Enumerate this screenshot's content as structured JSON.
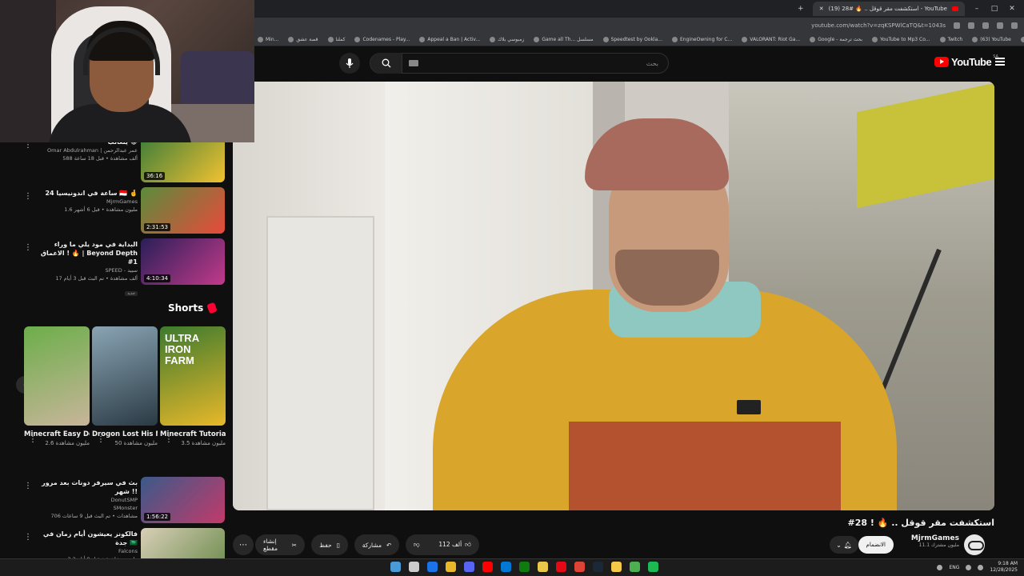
{
  "browser": {
    "tab_title": "(19) استكشفت مقر قوقل .. 🔥 #28 - YouTube",
    "url": "youtube.com/watch?v=zqKSPWlCaTQ&t=1043s",
    "bookmarks": [
      "Min...",
      "قصة عشق",
      "كملنا",
      "Codenames - Play...",
      "Appeal a Ban | Activ...",
      "زمبوسي بلاك",
      "Game all Th... مسلسل",
      "Speedtest by Ookla...",
      "EngineOwning for C...",
      "VALORANT: Riot Ga...",
      "Google - بحث ترجمة",
      "YouTube to Mp3 Co...",
      "Twitch",
      "(63) YouTube",
      "Kick",
      "Messages"
    ]
  },
  "header": {
    "search_placeholder": "بحث",
    "logo_text": "YouTube",
    "logo_region": "SA"
  },
  "recommendations": [
    {
      "title": "يتعالب 😂",
      "channel": "Omar Abdulrahman | عمر عبدالرحمن",
      "views": "588 ألف مشاهدة • قبل 18 ساعة",
      "duration": "36:16",
      "colors": [
        "#3e7d3a",
        "#f2c230"
      ]
    },
    {
      "title": "24 ساعة في اندونيسيا 🇮🇩 🤞",
      "channel": "MjrmGames",
      "views": "1.6 مليون مشاهدة • قبل 6 أشهر",
      "duration": "2:31:53",
      "colors": [
        "#5a8c3c",
        "#e84a3a"
      ]
    },
    {
      "title": "البداية في مود يلي ما وراء الاعماق ! 🔥 | Beyond Depth #1",
      "channel": "SPEED - سبيد",
      "views": "17 ألف مشاهدة • تم البث قبل 3 أيام",
      "duration": "4:10:34",
      "colors": [
        "#2a1f58",
        "#c23a8a"
      ],
      "chip": "جديد"
    }
  ],
  "shorts": {
    "heading": "Shorts",
    "items": [
      {
        "title": "Minecraft Easy Design...",
        "views": "2.6 مليون مشاهدة",
        "colors": [
          "#6cae4a",
          "#c8b59a"
        ]
      },
      {
        "title": "Drogon Lost His Mother",
        "views": "50 مليون مشاهدة",
        "colors": [
          "#8aa4b4",
          "#2a3a44"
        ]
      },
      {
        "title": "Minecraft Tutorial |",
        "views": "3.5 مليون مشاهدة",
        "colors": [
          "#3c7a2e",
          "#e8b82a"
        ],
        "overlay": "ULTRA IRON FARM"
      }
    ]
  },
  "recommendations_lower": [
    {
      "title": "بث في سيرفر دونات بعد مرور شهر !!",
      "channel": "DonutSMP",
      "channel2": "SMonster",
      "views": "706 مشاهدات • تم البث قبل 9 ساعات",
      "duration": "1:56:22",
      "colors": [
        "#3a5a8a",
        "#c23a6a"
      ]
    },
    {
      "title": "فالكونز يعيشون أيام زمان في جدة 🇸🇦",
      "channel": "Falcons",
      "views": "2.2 مليون مشاهدة • قبل 9 أيام",
      "duration": "",
      "colors": [
        "#d8cfb8",
        "#6a8a4a"
      ]
    }
  ],
  "video": {
    "title": "استكشفت مقر قوقل .. 🔥 ! 28#",
    "channel": "MjrmGames",
    "subscribers": "11.1 مليون مشترك",
    "join_label": "الانضمام",
    "likes": "112 ألف",
    "share_label": "مشاركة",
    "save_label": "حفظ",
    "clip_label": "إنشاء مقطع"
  },
  "taskbar": {
    "lang": "ENG",
    "time": "9:18 AM",
    "date": "12/28/2025",
    "app_colors": [
      "#4a9ad8",
      "#cccccc",
      "#1a73e8",
      "#e8b82a",
      "#5865f2",
      "#ff0000",
      "#0078d4",
      "#107c10",
      "#e8c84a",
      "#e50914",
      "#db4437",
      "#1b2838",
      "#f7c948",
      "#4caf50",
      "#1db954"
    ]
  }
}
